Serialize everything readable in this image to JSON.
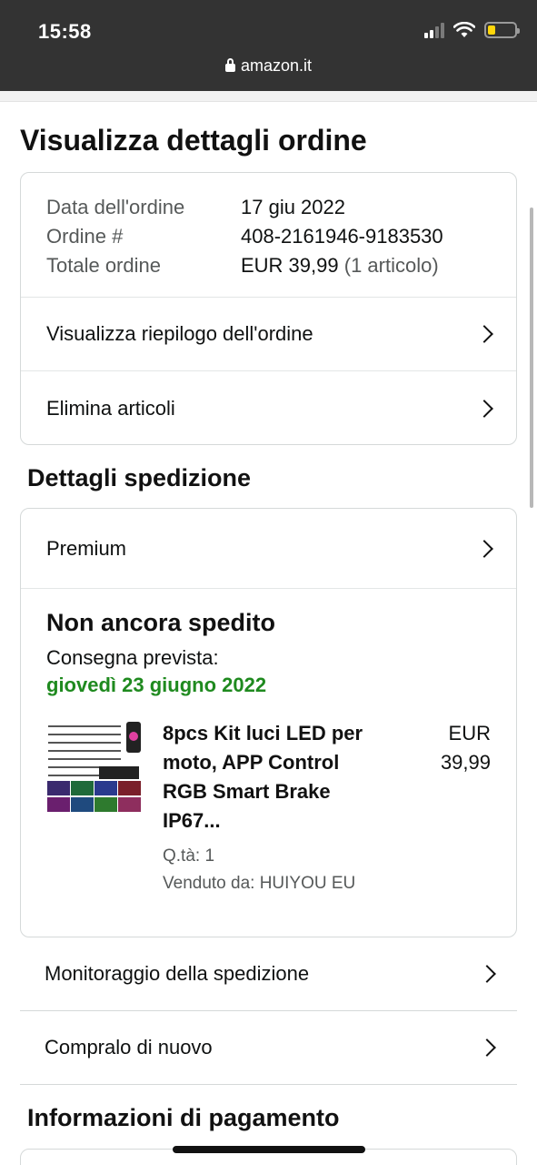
{
  "status_bar": {
    "time": "15:58",
    "url": "amazon.it"
  },
  "page": {
    "title": "Visualizza dettagli ordine"
  },
  "order_summary": {
    "rows": [
      {
        "label": "Data dell'ordine",
        "value": "17 giu 2022",
        "extra": ""
      },
      {
        "label": "Ordine #",
        "value": "408-2161946-9183530",
        "extra": ""
      },
      {
        "label": "Totale ordine",
        "value": "EUR 39,99",
        "extra": "(1 articolo)"
      }
    ],
    "links": [
      "Visualizza riepilogo dell'ordine",
      "Elimina articoli"
    ]
  },
  "shipping": {
    "section_title": "Dettagli spedizione",
    "method": "Premium",
    "status": "Non ancora spedito",
    "delivery_label": "Consegna prevista:",
    "delivery_date": "giovedì 23 giugno 2022",
    "product": {
      "title": "8pcs Kit luci LED per moto, APP Control RGB Smart Brake IP67...",
      "qty": "Q.tà: 1",
      "seller": "Venduto da: HUIYOU EU",
      "price_currency": "EUR",
      "price_value": "39,99"
    }
  },
  "actions": [
    "Monitoraggio della spedizione",
    "Compralo di nuovo"
  ],
  "payment": {
    "section_title": "Informazioni di pagamento"
  },
  "colors": {
    "delivery_green": "#1f8a1f",
    "topbar": "#333333",
    "battery": "#ffd60a"
  }
}
